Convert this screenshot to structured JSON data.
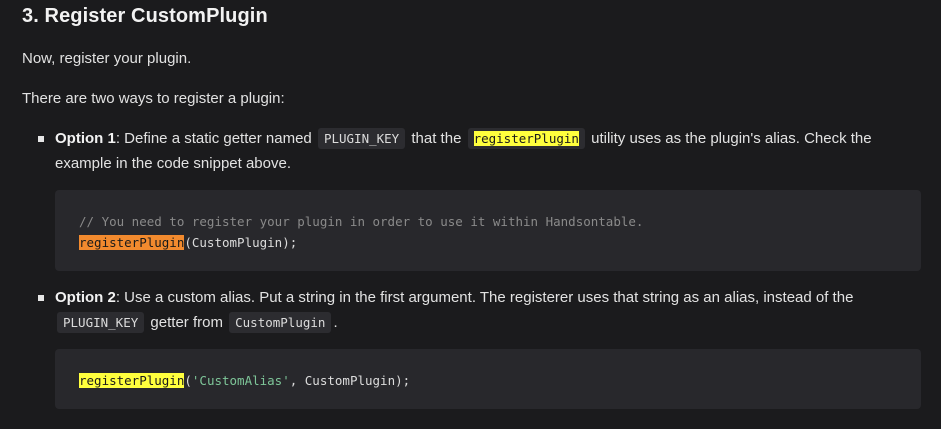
{
  "heading": "3. Register CustomPlugin",
  "para1": "Now, register your plugin.",
  "para2": "There are two ways to register a plugin:",
  "option1": {
    "label": "Option 1",
    "text_a": ": Define a static getter named ",
    "code_a": "PLUGIN_KEY",
    "text_b": " that the ",
    "code_b": "registerPlugin",
    "text_c": " utility uses as the plugin's alias. Check the example in the code snippet above."
  },
  "code1": {
    "comment": "// You need to register your plugin in order to use it within Handsontable.",
    "fn": "registerPlugin",
    "args": "(CustomPlugin);"
  },
  "option2": {
    "label": "Option 2",
    "text_a": ": Use a custom alias. Put a string in the first argument. The registerer uses that string as an alias, instead of the ",
    "code_a": "PLUGIN_KEY",
    "text_b": " getter from ",
    "code_b": "CustomPlugin",
    "text_c": "."
  },
  "code2": {
    "fn": "registerPlugin",
    "open": "(",
    "str": "'CustomAlias'",
    "rest": ", CustomPlugin);"
  },
  "colors": {
    "background": "#1b1b1d",
    "code_background": "#28282c",
    "highlight_yellow": "#ffff3d",
    "highlight_orange": "#f28a2e",
    "string_green": "#7ec699"
  }
}
